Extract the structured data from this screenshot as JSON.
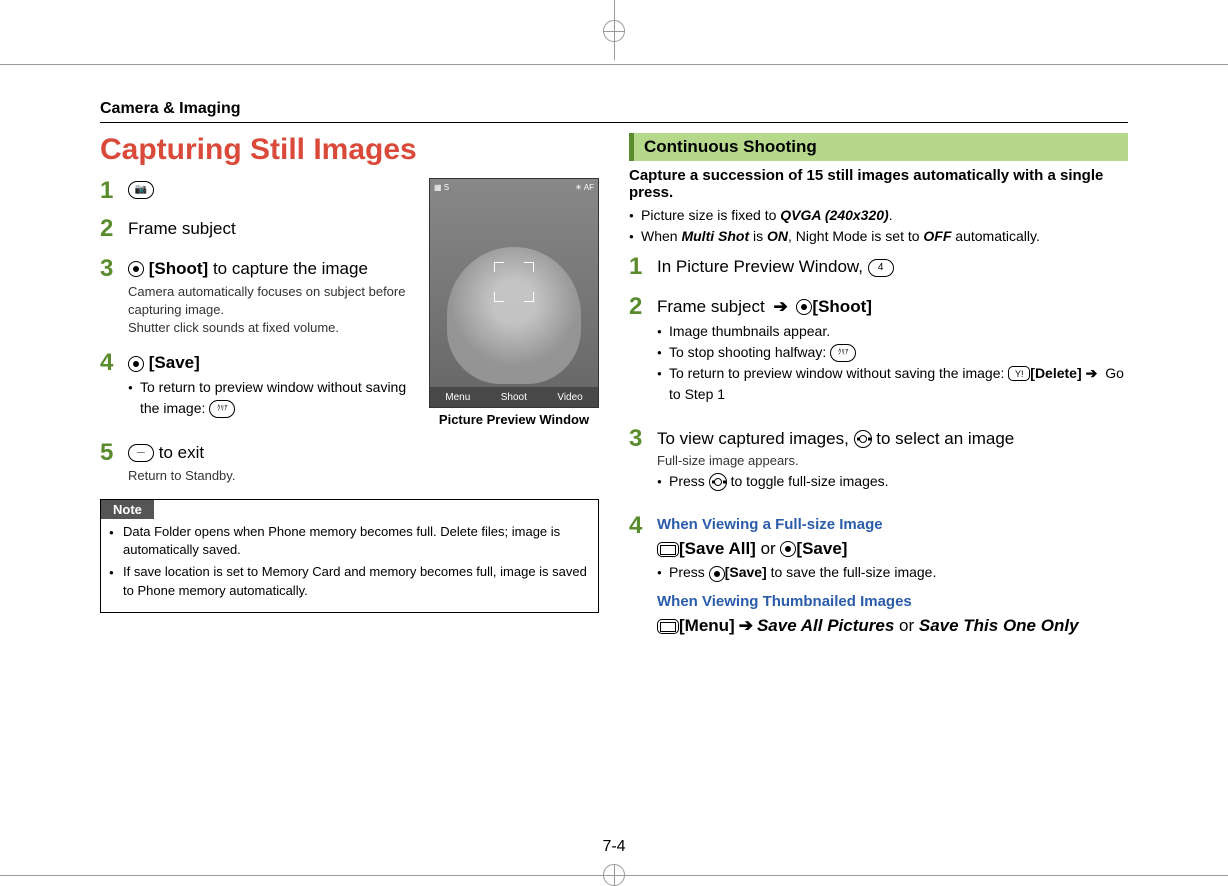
{
  "header": "Camera & Imaging",
  "title": "Capturing Still Images",
  "preview_caption": "Picture Preview Window",
  "preview_bottom": {
    "left": "Menu",
    "center": "Shoot",
    "right": "Video"
  },
  "left_steps": {
    "s1": {
      "num": "1"
    },
    "s2": {
      "num": "2",
      "text": "Frame subject"
    },
    "s3": {
      "num": "3",
      "label": "[Shoot]",
      "rest": " to capture the image",
      "sub1": "Camera automatically focuses on subject before capturing image.",
      "sub2": "Shutter click sounds at fixed volume."
    },
    "s4": {
      "num": "4",
      "label": "[Save]",
      "bullet": "To return to preview window without saving the image: "
    },
    "s5": {
      "num": "5",
      "text": " to exit",
      "sub": "Return to Standby."
    }
  },
  "note": {
    "label": "Note",
    "items": [
      "Data Folder opens when Phone memory becomes full. Delete files; image is automatically saved.",
      "If save location is set to Memory Card and memory becomes full, image is saved to Phone memory automatically."
    ]
  },
  "right": {
    "heading": "Continuous Shooting",
    "intro": "Capture a succession of 15 still images automatically with a single press.",
    "b1a": "Picture size is fixed to ",
    "b1b": "QVGA (240x320)",
    "b1c": ".",
    "b2a": "When ",
    "b2b": "Multi Shot",
    "b2c": " is ",
    "b2d": "ON",
    "b2e": ", Night Mode is set to ",
    "b2f": "OFF",
    "b2g": " automatically.",
    "s1": {
      "num": "1",
      "text": "In Picture Preview Window, ",
      "key": "4"
    },
    "s2": {
      "num": "2",
      "text": "Frame subject ",
      "label": "[Shoot]",
      "u1": "Image thumbnails appear.",
      "u2": "To stop shooting halfway: ",
      "u3a": "To return to preview window without saving the image: ",
      "u3b": "[Delete]",
      "u3c": " Go to Step 1"
    },
    "s3": {
      "num": "3",
      "text1": "To view captured images, ",
      "text2": " to select an image",
      "sub": "Full-size image appears.",
      "u1a": "Press ",
      "u1b": " to toggle full-size images."
    },
    "s4": {
      "num": "4",
      "h1": "When Viewing a Full-size Image",
      "l1": "[Save All]",
      "or": " or ",
      "l2": "[Save]",
      "u1a": "Press ",
      "u1b": "[Save]",
      "u1c": " to save the full-size image.",
      "h2": "When Viewing Thumbnailed Images",
      "l3": "[Menu]",
      "l4": "Save All Pictures",
      "or2": " or ",
      "l5": "Save This One Only"
    }
  },
  "pagenum": "7-4"
}
